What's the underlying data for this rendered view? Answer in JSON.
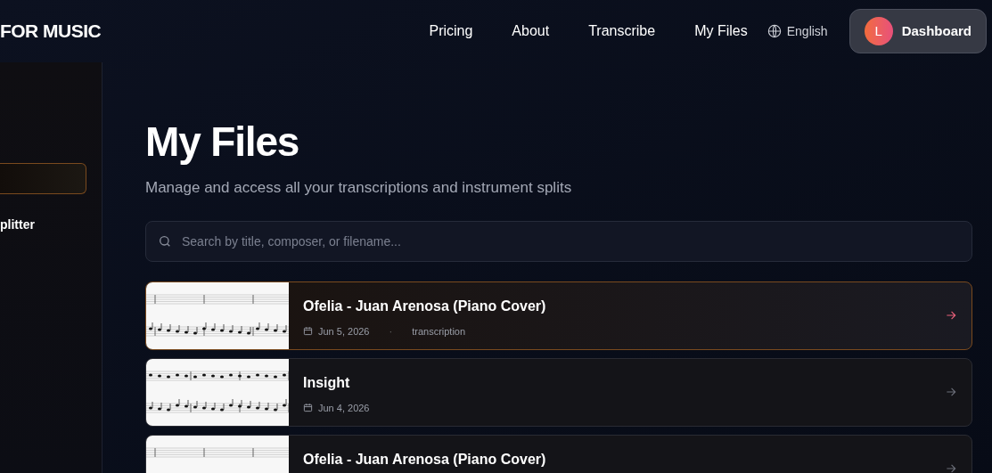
{
  "header": {
    "logo": "FOR MUSIC",
    "nav": [
      {
        "label": "Pricing"
      },
      {
        "label": "About"
      },
      {
        "label": "Transcribe"
      },
      {
        "label": "My Files"
      }
    ],
    "language": "English",
    "dashboard": {
      "avatar": "L",
      "label": "Dashboard"
    }
  },
  "sidebar": {
    "items": [
      {
        "selected": true
      },
      {
        "label": "plitter",
        "selected": false
      }
    ]
  },
  "page": {
    "title": "My Files",
    "subtitle": "Manage and access all your transcriptions and instrument splits"
  },
  "search": {
    "placeholder": "Search by title, composer, or filename..."
  },
  "files": [
    {
      "title": "Ofelia - Juan Arenosa (Piano Cover)",
      "date": "Jun 5, 2026",
      "separator": "·",
      "type": "transcription",
      "selected": true
    },
    {
      "title": "Insight",
      "date": "Jun 4, 2026",
      "selected": false
    },
    {
      "title": "Ofelia - Juan Arenosa (Piano Cover)",
      "selected": false
    }
  ]
}
